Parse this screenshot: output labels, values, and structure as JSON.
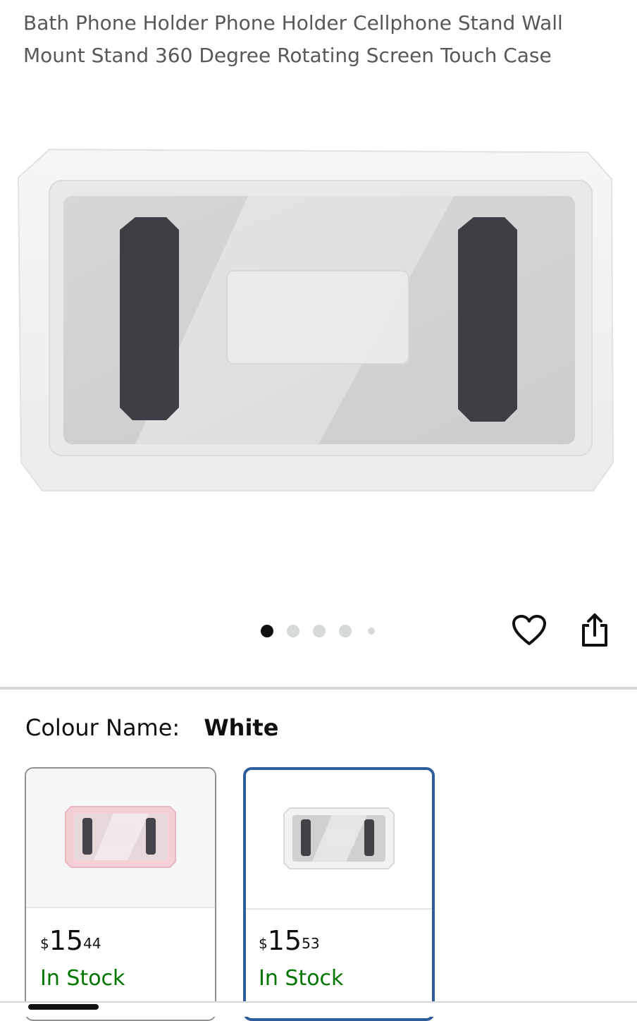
{
  "product": {
    "title": "Bath Phone Holder Phone Holder Cellphone Stand Wall Mount Stand 360 Degree Rotating Screen Touch Case"
  },
  "gallery": {
    "image_count": 5,
    "active_index": 0,
    "actions": {
      "wishlist_icon": "heart-outline-icon",
      "share_icon": "share-upload-icon"
    }
  },
  "variation": {
    "label": "Colour Name:",
    "selected_value": "White",
    "swatches": [
      {
        "color_name": "Pink",
        "frame_color": "#f4cfd4",
        "price_currency": "$",
        "price_whole": "15",
        "price_fraction": "44",
        "availability": "In Stock",
        "selected": false
      },
      {
        "color_name": "White",
        "frame_color": "#f2f2f2",
        "price_currency": "$",
        "price_whole": "15",
        "price_fraction": "53",
        "availability": "In Stock",
        "selected": true
      }
    ]
  },
  "colors": {
    "in_stock": "#007600",
    "selected_border": "#2e5d99",
    "title_gray": "#565959"
  }
}
